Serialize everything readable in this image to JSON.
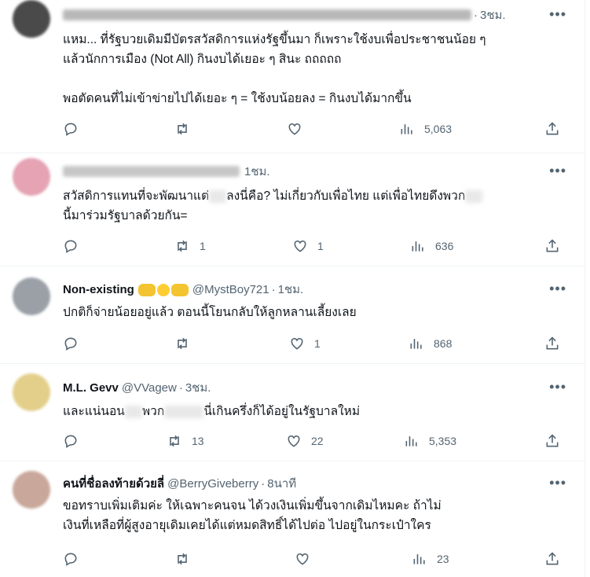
{
  "tweets": [
    {
      "name": "",
      "handle": "",
      "time": "3ชม.",
      "lines": [
        "แหม... ที่รัฐบวยเดิมมีบัตรสวัสดิการแห่งรัฐขึ้นมา ก็เพราะใช้งบเพื่อประชาชนน้อย ๆ",
        "แล้วนักการเมือง (Not All) กินงบได้เยอะ ๆ สินะ ถถถถถ",
        "",
        "พอตัดคนที่ไม่เข้าข่ายไปได้เยอะ ๆ = ใช้งบน้อยลง = กินงบได้มากขึ้น"
      ],
      "replies": "",
      "retweets": "",
      "likes": "",
      "views": "5,063"
    },
    {
      "name": "",
      "handle": "",
      "time": "1ชม.",
      "line1a": "สวัสดิการแทนที่จะพัฒนาแต่",
      "line1b": "ลงนี่คือ? ไม่เกี่ยวกับเพื่อไทย แต่เพื่อไทยดึงพวก",
      "line2": "นี้มาร่วมรัฐบาลด้วยกัน=",
      "replies": "",
      "retweets": "1",
      "likes": "1",
      "views": "636"
    },
    {
      "name": "Non-existing",
      "handle": "@MystBoy721",
      "time": "1ชม.",
      "lines": [
        "ปกติก็จ่ายน้อยอยู่แล้ว ตอนนี้โยนกลับให้ลูกหลานเลี้ยงเลย"
      ],
      "replies": "",
      "retweets": "",
      "likes": "1",
      "views": "868"
    },
    {
      "name": "M.L. Gevv",
      "handle": "@VVagew",
      "time": "3ชม.",
      "line1a": "และแน่นอน",
      "line1b": "พวก",
      "line1c": "นี่เกินครึ่งก็ได้อยู่ในรัฐบาลใหม่",
      "replies": "",
      "retweets": "13",
      "likes": "22",
      "views": "5,353"
    },
    {
      "name": "คนที่ชื่อลงท้ายด้วยลี่",
      "handle": "@BerryGiveberry",
      "time": "8นาที",
      "lines": [
        "ขอทราบเพิ่มเติมค่ะ ให้เฉพาะคนจน ได้วงเงินเพิ่มขึ้นจากเดิมไหมคะ ถ้าไม่",
        "เงินที่เหลือที่ผู้สูงอายุเดิมเคยได้แต่หมดสิทธิ์ได้ไปต่อ ไปอยู่ในกระเป๋าใคร"
      ],
      "replies": "",
      "retweets": "",
      "likes": "",
      "views": "23"
    }
  ],
  "icons": {
    "reply": "reply-icon",
    "retweet": "retweet-icon",
    "like": "like-icon",
    "views": "views-icon",
    "share": "share-icon",
    "more": "more-icon"
  },
  "colors": {
    "text": "#0f1419",
    "secondary": "#536471",
    "divider": "#eff3f4"
  }
}
